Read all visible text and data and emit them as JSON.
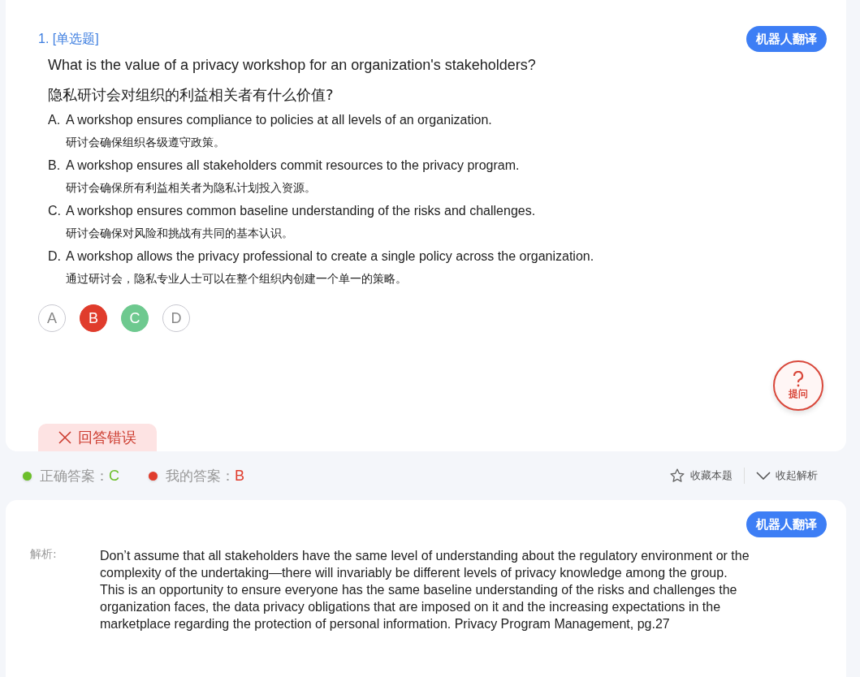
{
  "question": {
    "number": "1.",
    "type": "[单选题]",
    "translate_button": "机器人翻译",
    "text_en": "What is the value of a privacy workshop for an organization's stakeholders?",
    "text_zh": "隐私研讨会对组织的利益相关者有什么价值?",
    "options": [
      {
        "letter": "A.",
        "en": "A workshop ensures compliance to policies at all levels of an organization.",
        "zh": "研讨会确保组织各级遵守政策。"
      },
      {
        "letter": "B.",
        "en": "A workshop ensures all stakeholders commit resources to the privacy program.",
        "zh": "研讨会确保所有利益相关者为隐私计划投入资源。"
      },
      {
        "letter": "C.",
        "en": "A workshop ensures common baseline understanding of the risks and challenges.",
        "zh": "研讨会确保对风险和挑战有共同的基本认识。"
      },
      {
        "letter": "D.",
        "en": "A workshop allows the privacy professional to create a single policy across the organization.",
        "zh": "通过研讨会，隐私专业人士可以在整个组织内创建一个单一的策略。"
      }
    ],
    "answer_bubbles": [
      {
        "label": "A",
        "kind": "none"
      },
      {
        "label": "B",
        "kind": "wrong"
      },
      {
        "label": "C",
        "kind": "correct"
      },
      {
        "label": "D",
        "kind": "none"
      }
    ],
    "ask_button": "提问",
    "result": {
      "kind": "wrong",
      "label": "回答错误"
    }
  },
  "answer_bar": {
    "answers": [
      {
        "label": "正确答案：",
        "value": "C",
        "color": "#6cbf2a"
      },
      {
        "label": "我的答案：",
        "value": "B",
        "color": "#e03c2c"
      }
    ],
    "actions": [
      {
        "kind": "star",
        "label": "收藏本题"
      },
      {
        "kind": "collapse",
        "label": "收起解析"
      }
    ]
  },
  "explanation": {
    "translate_button": "机器人翻译",
    "label": "解析:",
    "text": "Don’t assume that all stakeholders have the same level of understanding about the regulatory environment or the complexity of the undertaking—there will invariably be different levels of privacy knowledge among the group. This is an opportunity to ensure everyone has the same baseline understanding of the risks and challenges the organization faces, the data privacy obligations that are imposed on it and the increasing expectations in the marketplace regarding the protection of personal information. Privacy Program Management, pg.27"
  }
}
